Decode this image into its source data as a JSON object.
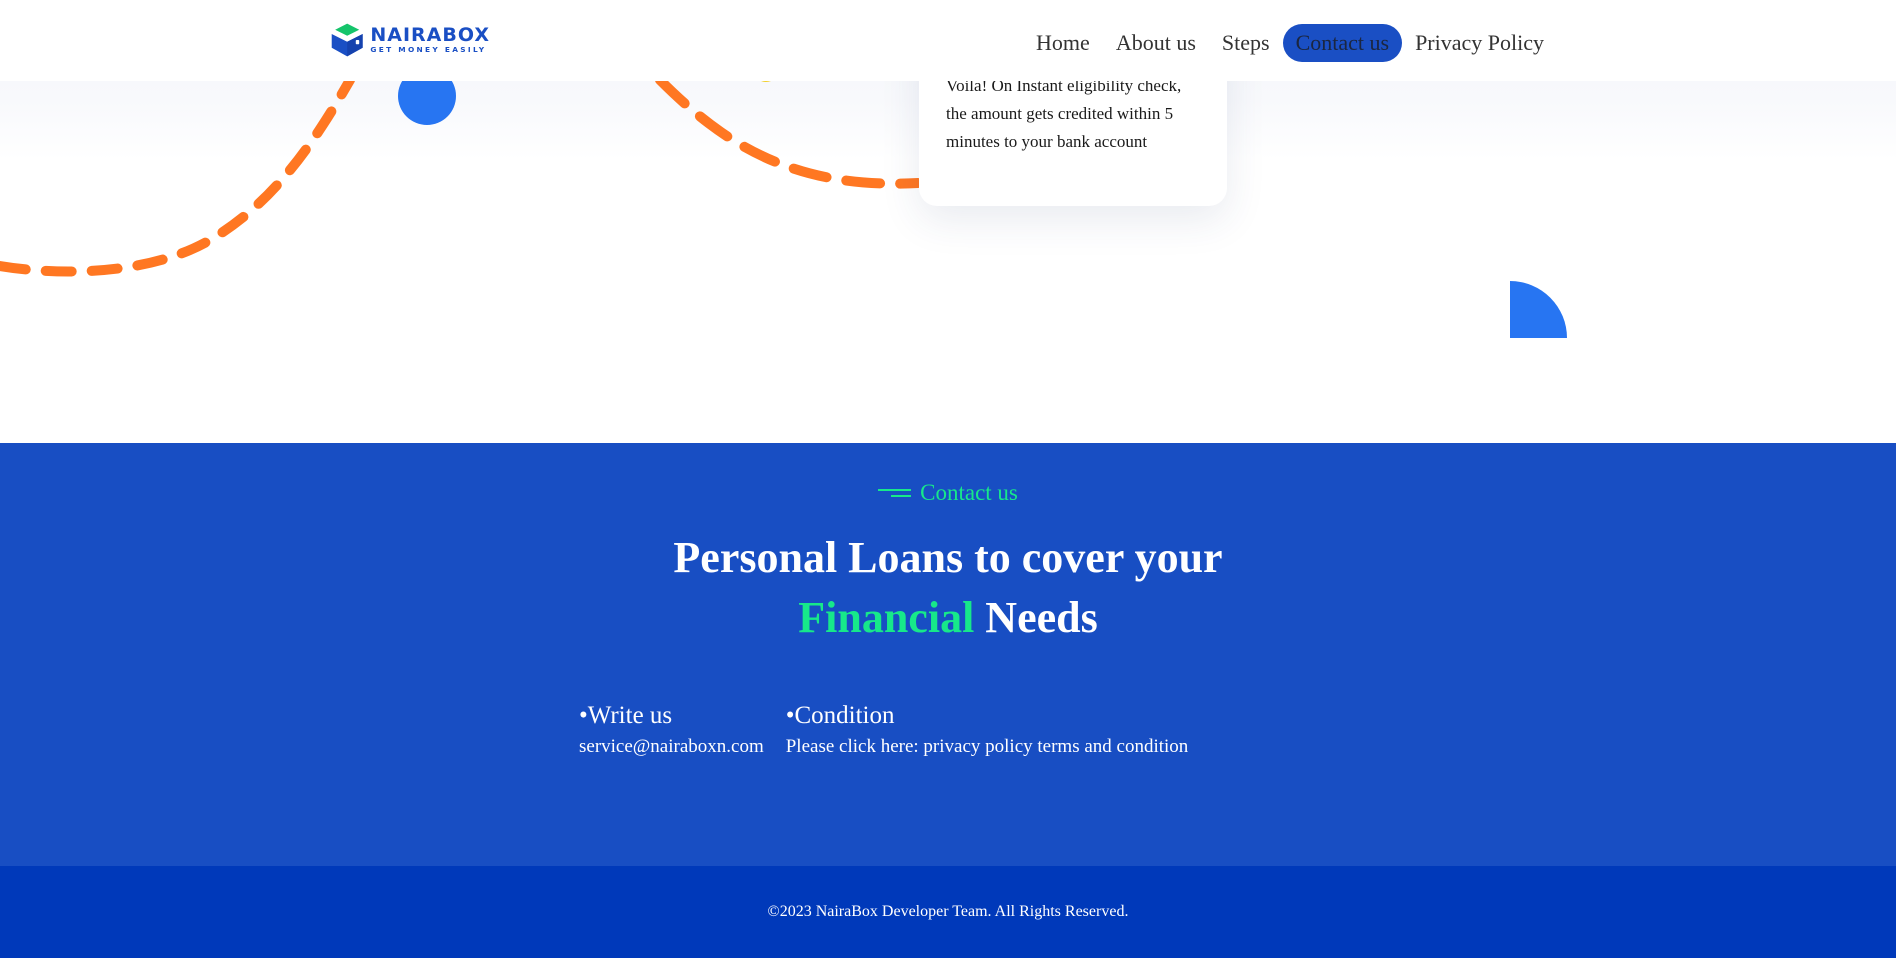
{
  "brand": {
    "name": "NAIRABOX",
    "tagline": "GET MONEY EASILY",
    "colors": {
      "primary": "#1a4fc4",
      "green": "#17e88a",
      "orange": "#ff7722",
      "footer": "#0039ba"
    }
  },
  "nav": {
    "items": [
      {
        "label": "Home",
        "active": false
      },
      {
        "label": "About us",
        "active": false
      },
      {
        "label": "Steps",
        "active": false
      },
      {
        "label": "Contact us",
        "active": true
      },
      {
        "label": "Privacy Policy",
        "active": false
      }
    ]
  },
  "hero": {
    "step_card_text": "Voila! On Instant eligibility check, the amount gets credited within 5 minutes to your bank account"
  },
  "contact": {
    "eyebrow": "Contact us",
    "title_line1": "Personal Loans to cover your",
    "title_accent": "Financial",
    "title_rest": "Needs",
    "columns": [
      {
        "heading": "•Write us",
        "text": "service@nairaboxn.com"
      },
      {
        "heading": "•Condition",
        "text": "Please click here: privacy policy terms and condition"
      }
    ]
  },
  "footer": {
    "copyright": "©2023 NairaBox Developer Team. All Rights Reserved."
  }
}
